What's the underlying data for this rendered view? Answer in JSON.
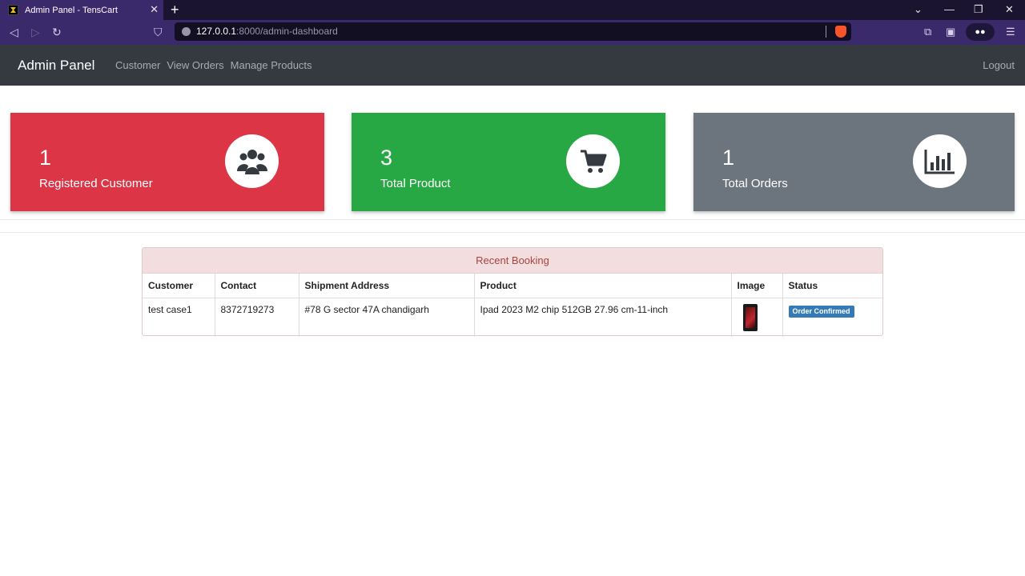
{
  "browser": {
    "tab_title": "Admin Panel - TensCart",
    "url_host": "127.0.0.1",
    "url_rest": ":8000/admin-dashboard"
  },
  "nav": {
    "brand": "Admin Panel",
    "links": [
      "Customer",
      "View Orders",
      "Manage Products"
    ],
    "logout": "Logout"
  },
  "cards": [
    {
      "count": "1",
      "label": "Registered Customer",
      "color": "#dc3545",
      "icon": "users-icon"
    },
    {
      "count": "3",
      "label": "Total Product",
      "color": "#28a745",
      "icon": "cart-icon"
    },
    {
      "count": "1",
      "label": "Total Orders",
      "color": "#6c757d",
      "icon": "bar-chart-icon"
    }
  ],
  "bookings": {
    "heading": "Recent Booking",
    "columns": [
      "Customer",
      "Contact",
      "Shipment Address",
      "Product",
      "Image",
      "Status"
    ],
    "rows": [
      {
        "customer": "test case1",
        "contact": "8372719273",
        "address": "#78 G sector 47A chandigarh",
        "product": "Ipad 2023 M2 chip 512GB 27.96 cm-11-inch",
        "image": "ipad-thumbnail",
        "status": "Order Confirmed"
      }
    ]
  }
}
